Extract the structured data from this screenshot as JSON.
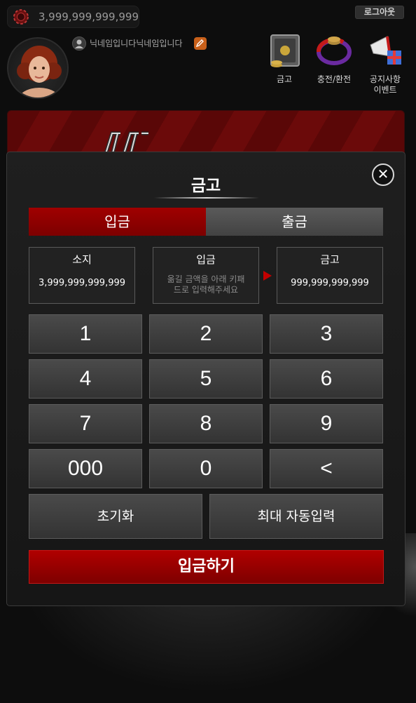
{
  "header": {
    "balance": "3,999,999,999,999",
    "logout_label": "로그아웃",
    "nickname": "닉네임입니다닉네임입니다"
  },
  "top_icons": [
    {
      "label": "금고",
      "icon": "vault-icon"
    },
    {
      "label": "충전/환전",
      "icon": "exchange-icon"
    },
    {
      "label": "공지사항",
      "label2": "이벤트",
      "icon": "megaphone-gift-icon"
    }
  ],
  "modal": {
    "title": "금고",
    "tabs": [
      {
        "label": "입금",
        "active": true
      },
      {
        "label": "출금",
        "active": false
      }
    ],
    "held": {
      "title": "소지",
      "value": "3,999,999,999,999"
    },
    "deposit": {
      "title": "입금",
      "hint_line1": "옮길 금액을 아래 키패",
      "hint_line2": "드로 입력해주세요"
    },
    "vault": {
      "title": "금고",
      "value": "999,999,999,999"
    },
    "keys": [
      "1",
      "2",
      "3",
      "4",
      "5",
      "6",
      "7",
      "8",
      "9",
      "000",
      "0",
      "<"
    ],
    "reset_label": "초기화",
    "max_label": "최대 자동입력",
    "submit_label": "입금하기"
  },
  "colors": {
    "accent_red": "#a00000",
    "background": "#0d0d0d",
    "panel": "#1f1f1f"
  }
}
